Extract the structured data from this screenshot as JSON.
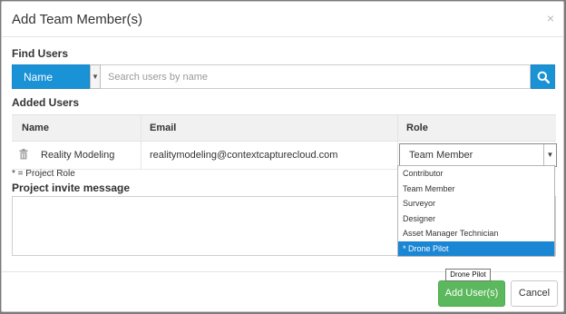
{
  "dialog": {
    "title": "Add Team Member(s)",
    "close_glyph": "×"
  },
  "find_users": {
    "label": "Find Users",
    "search_by": "Name",
    "placeholder": "Search users by name",
    "value": ""
  },
  "added_users": {
    "label": "Added Users",
    "columns": [
      "Name",
      "Email",
      "Role"
    ],
    "rows": [
      {
        "name": "Reality Modeling",
        "email": "realitymodeling@contextcapturecloud.com",
        "role": "Team Member"
      }
    ]
  },
  "role_dropdown": {
    "options": [
      "Contributor",
      "Team Member",
      "Surveyor",
      "Designer",
      "Asset Manager Technician",
      "* Drone Pilot"
    ],
    "highlighted_index": 5
  },
  "footnote": "* = Project Role",
  "invite": {
    "label": "Project invite message",
    "value": ""
  },
  "tooltip": "Drone Pilot",
  "footer": {
    "add_label": "Add User(s)",
    "cancel_label": "Cancel"
  },
  "colors": {
    "primary": "#1a92d6",
    "success": "#5cb85c",
    "selected_option": "#1a86d4"
  },
  "icons": {
    "close": "close-icon",
    "search": "search-icon",
    "delete": "trash-icon",
    "dropdown": "chevron-down-icon"
  }
}
